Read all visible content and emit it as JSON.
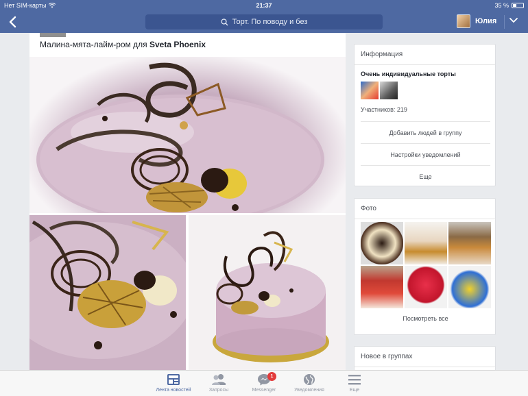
{
  "status_bar": {
    "carrier": "Нет SIM-карты",
    "time": "21:37",
    "battery": "35 %"
  },
  "nav": {
    "search_text": "Торт. По поводу и без",
    "user_name": "Юлия"
  },
  "post": {
    "title_prefix": "Малина-мята-лайм-ром для ",
    "title_name": "Sveta Phoenix"
  },
  "info_card": {
    "title": "Информация",
    "group_name": "Очень индивидуальные торты",
    "members": "Участников: 219",
    "add_people": "Добавить людей в группу",
    "notification_settings": "Настройки уведомлений",
    "more": "Еще"
  },
  "photo_card": {
    "title": "Фото",
    "see_all": "Посмотреть все"
  },
  "news_card": {
    "title": "Новое в группах"
  },
  "tabbar": {
    "items": [
      {
        "label": "Лента новостей",
        "icon": "news-feed-icon",
        "active": true
      },
      {
        "label": "Запросы",
        "icon": "friend-requests-icon",
        "active": false
      },
      {
        "label": "Messenger",
        "icon": "messenger-icon",
        "active": false,
        "badge": "1"
      },
      {
        "label": "Уведомления",
        "icon": "globe-icon",
        "active": false
      },
      {
        "label": "Еще",
        "icon": "menu-icon",
        "active": false
      }
    ]
  },
  "colors": {
    "brand_blue": "#4e69a2",
    "background": "#e9ebee",
    "badge_red": "#e23b3b"
  }
}
